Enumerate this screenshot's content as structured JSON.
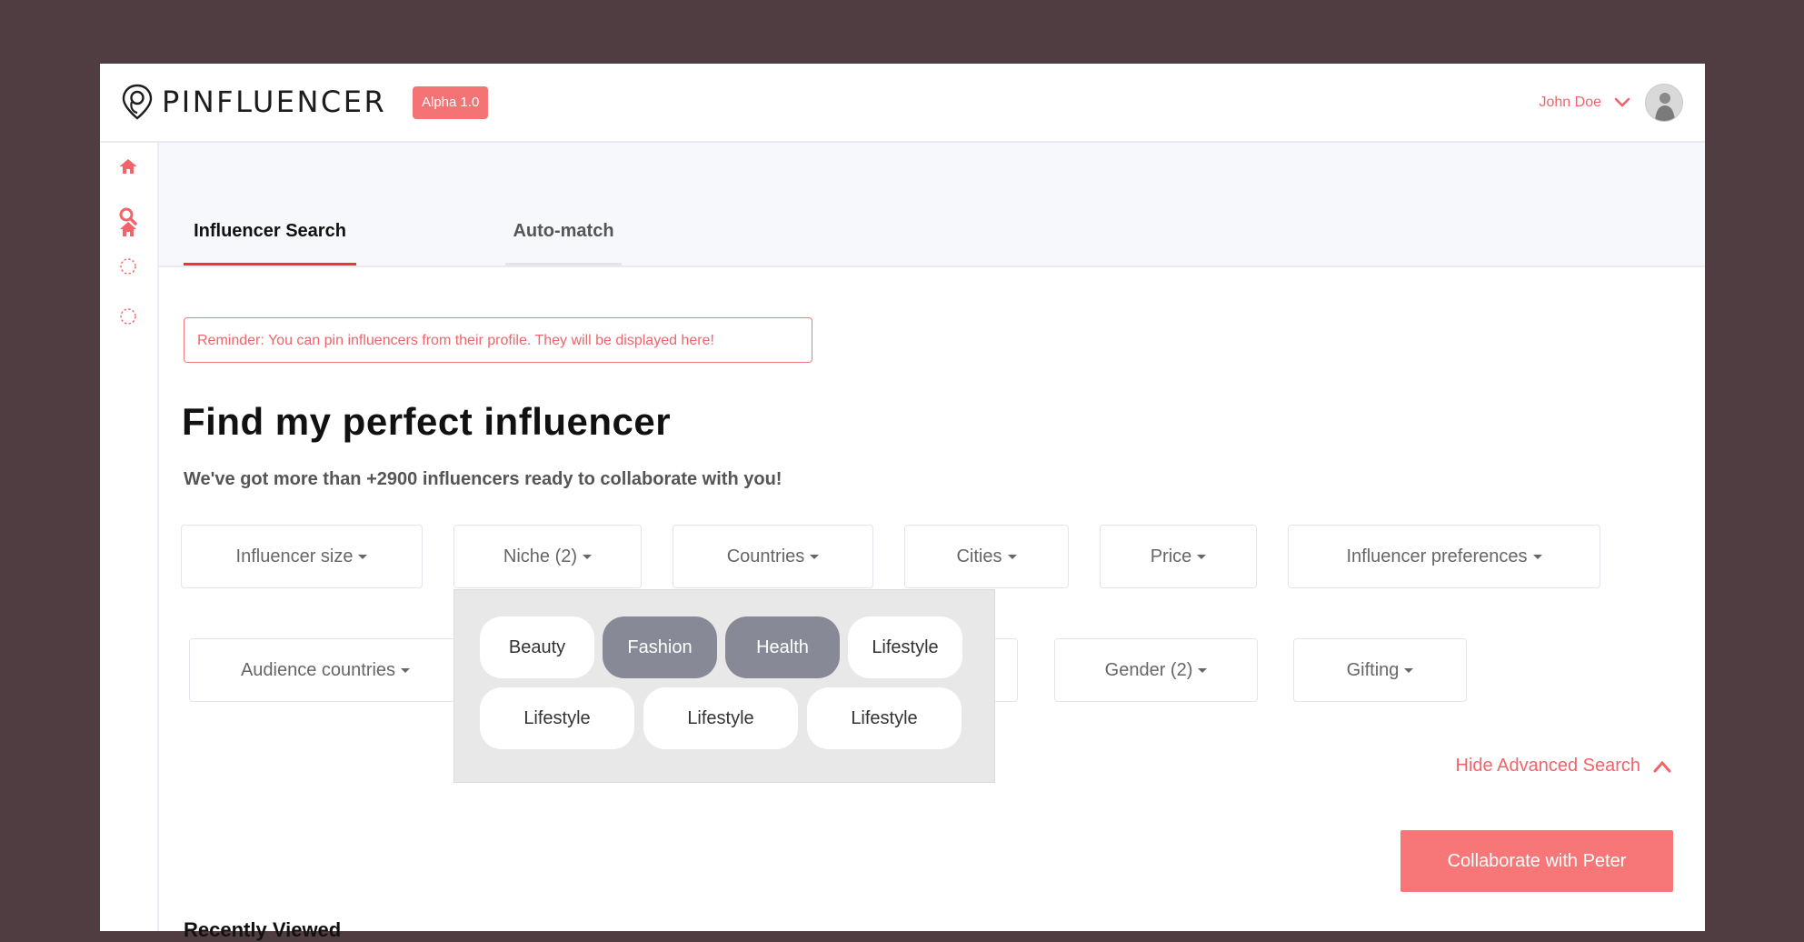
{
  "header": {
    "brand": "PINFLUENCER",
    "version_badge": "Alpha 1.0",
    "user_name": "John Doe"
  },
  "sidebar": {
    "items": [
      {
        "icon": "home-icon"
      },
      {
        "icon": "search-icon"
      },
      {
        "icon": "dotted-circle-icon"
      },
      {
        "icon": "dotted-circle-icon"
      }
    ]
  },
  "tabs": [
    {
      "label": "Influencer Search",
      "active": true
    },
    {
      "label": "Auto-match",
      "active": false
    }
  ],
  "reminder": "Reminder: You can pin influencers from their profile. They will be displayed here!",
  "main": {
    "title": "Find my perfect influencer",
    "subtitle": "We've got more than +2900 influencers ready to collaborate with you!"
  },
  "filters": {
    "row1": [
      "Influencer size",
      "Niche (2)",
      "Countries",
      "Cities",
      "Price",
      "Influencer preferences"
    ],
    "row2": [
      "Audience countries",
      "Gender (2)",
      "Gifting"
    ]
  },
  "niche_dropdown": {
    "options": [
      {
        "label": "Beauty",
        "selected": false
      },
      {
        "label": "Fashion",
        "selected": true
      },
      {
        "label": "Health",
        "selected": true
      },
      {
        "label": "Lifestyle",
        "selected": false
      },
      {
        "label": "Lifestyle",
        "selected": false
      },
      {
        "label": "Lifestyle",
        "selected": false
      },
      {
        "label": "Lifestyle",
        "selected": false
      }
    ]
  },
  "hide_advanced_label": "Hide Advanced Search",
  "cta_label": "Collaborate with Peter",
  "recent_label": "Recently Viewed",
  "colors": {
    "accent": "#f47375",
    "selected_chip": "#878a96",
    "background": "#503d42"
  }
}
